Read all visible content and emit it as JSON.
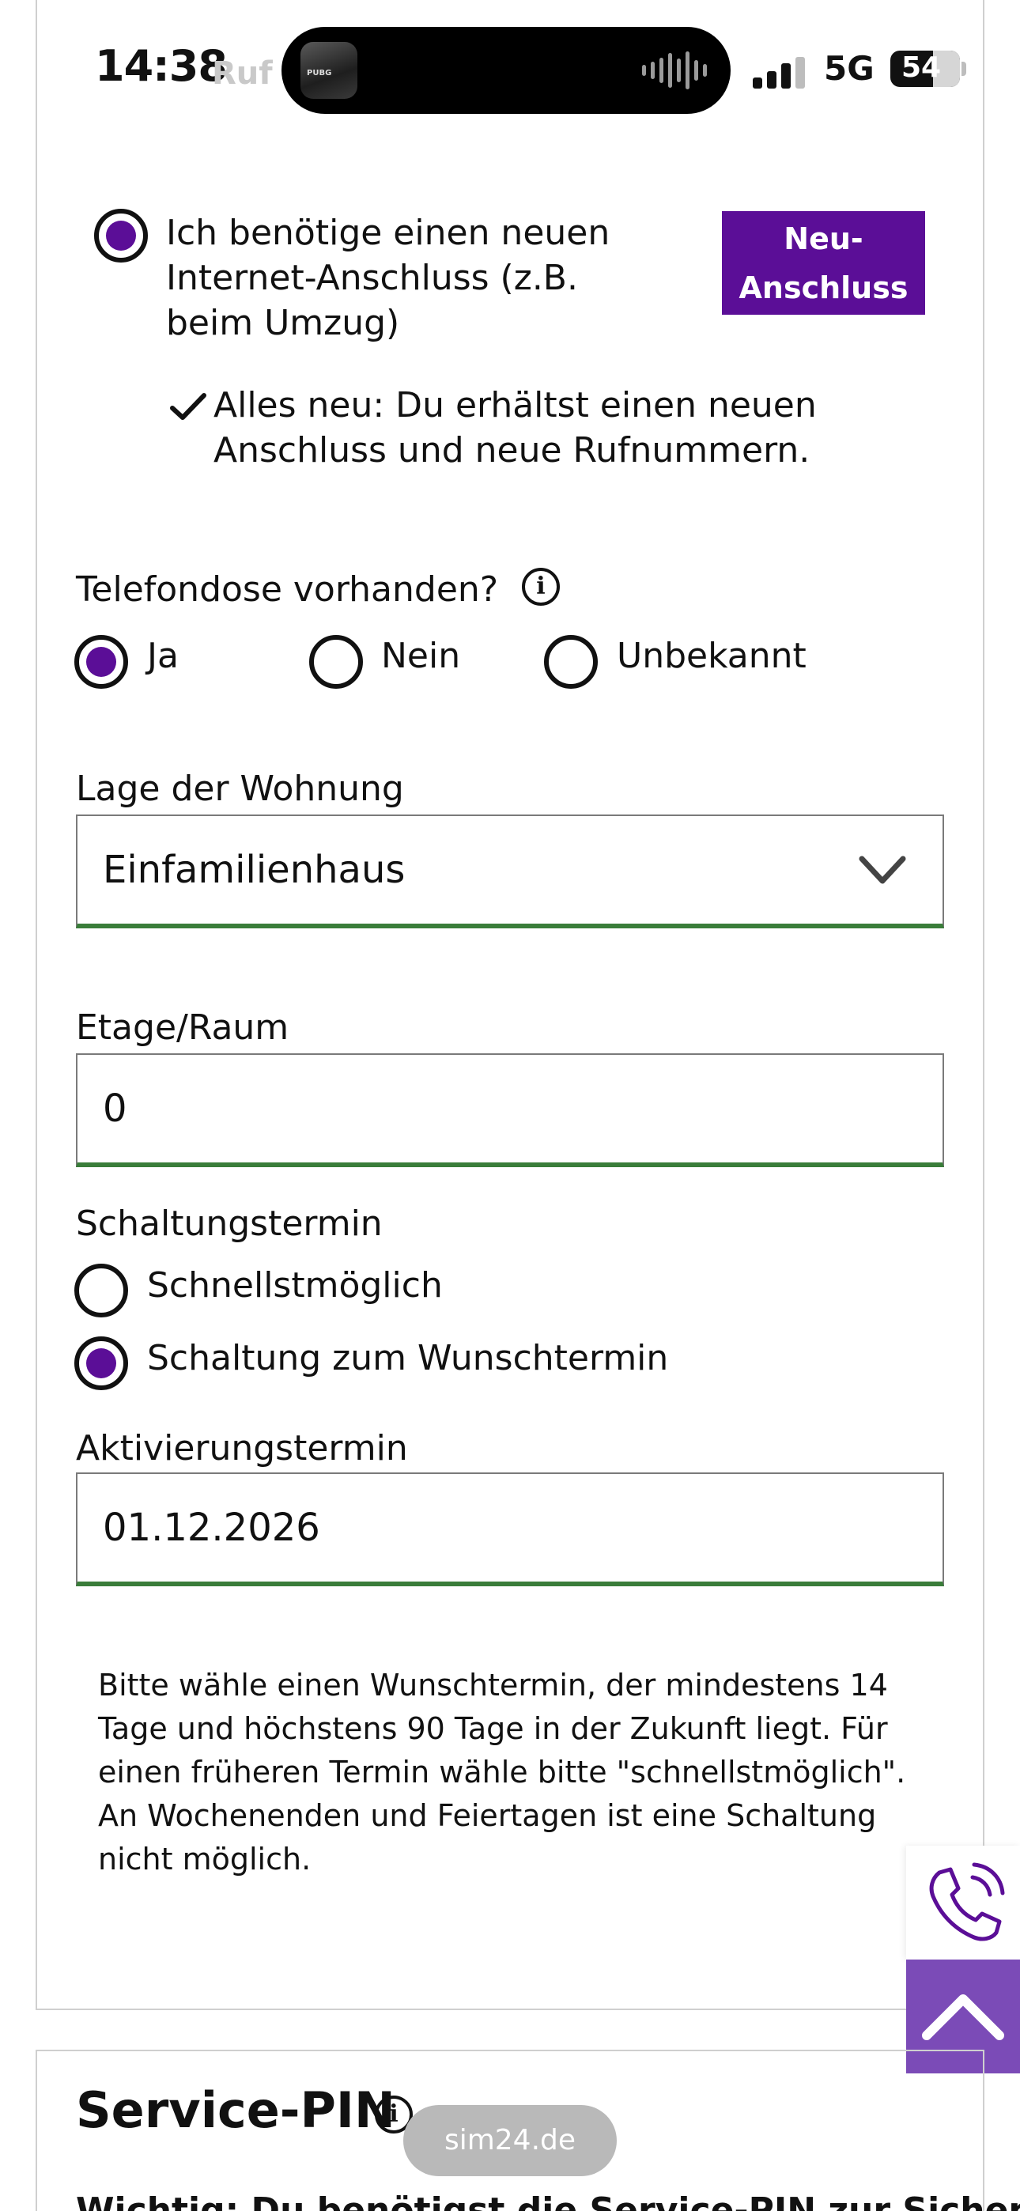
{
  "status_bar": {
    "time": "14:38",
    "faded_text": "Ruf",
    "app_icon_text": "PUBG",
    "network": "5G",
    "battery": "54"
  },
  "connection": {
    "option_label": "Ich benötige einen neuen Internet-Anschluss (z.B. beim Umzug)",
    "badge": "Neu-Anschluss",
    "check_note": "Alles neu: Du erhältst einen neuen Anschluss und neue Rufnummern.",
    "selected": true
  },
  "telefondose": {
    "label": "Telefondose vorhanden?",
    "options": [
      {
        "label": "Ja",
        "selected": true
      },
      {
        "label": "Nein",
        "selected": false
      },
      {
        "label": "Unbekannt",
        "selected": false
      }
    ]
  },
  "lage": {
    "label": "Lage der Wohnung",
    "value": "Einfamilienhaus"
  },
  "etage": {
    "label": "Etage/Raum",
    "value": "0"
  },
  "schaltung": {
    "label": "Schaltungstermin",
    "options": [
      {
        "label": "Schnellstmöglich",
        "selected": false
      },
      {
        "label": "Schaltung zum Wunschtermin",
        "selected": true
      }
    ]
  },
  "aktivierung": {
    "label": "Aktivierungstermin",
    "value": "01.12.2026"
  },
  "note": "Bitte wähle einen Wunschtermin, der mindestens 14 Tage und höchstens 90 Tage in der Zukunft liegt. Für einen früheren Termin wähle bitte \"schnellstmöglich\". An Wochenenden und Feiertagen ist eine Schaltung nicht möglich.",
  "service_pin": {
    "title": "Service-PIN",
    "cut_text": "Wichtig: Du benötigst die Service-PIN zur Sicherheit"
  },
  "browser": {
    "url": "sim24.de"
  },
  "colors": {
    "accent": "#5b0e97",
    "field_border_ok": "#3a7d3a",
    "scroll_top_bg": "#7b4bb7"
  }
}
